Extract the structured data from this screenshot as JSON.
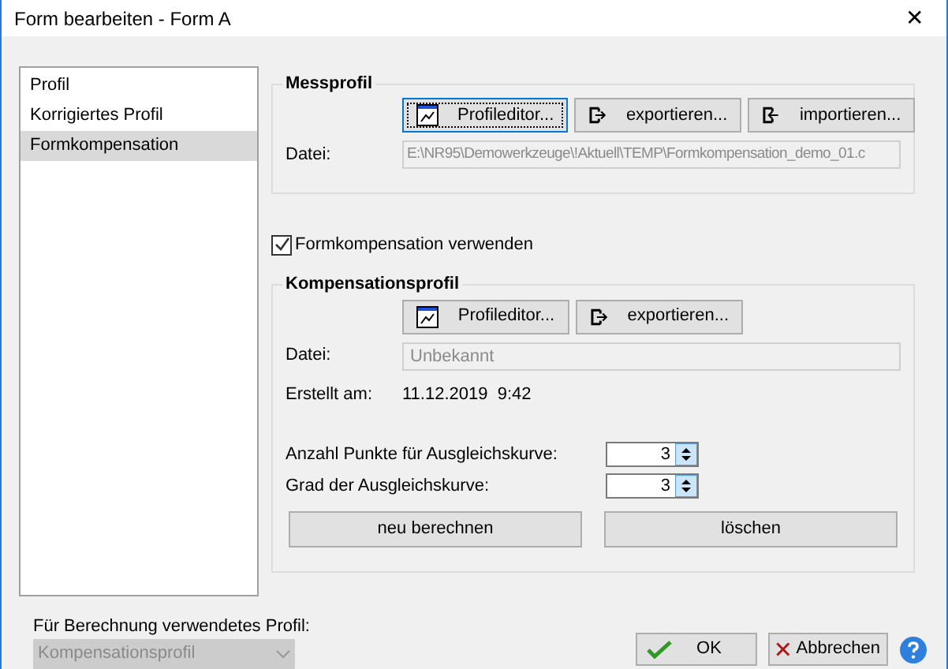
{
  "window": {
    "title": "Form bearbeiten - Form A",
    "close": "✕"
  },
  "sidebar": {
    "items": [
      {
        "label": "Profil",
        "selected": false
      },
      {
        "label": "Korrigiertes Profil",
        "selected": false
      },
      {
        "label": "Formkompensation",
        "selected": true
      }
    ]
  },
  "messprofil": {
    "title": "Messprofil",
    "buttons": [
      {
        "label": "Profileditor...",
        "kind": "editor",
        "focused": true
      },
      {
        "label": "exportieren...",
        "kind": "export",
        "focused": false
      },
      {
        "label": "importieren...",
        "kind": "import",
        "focused": false
      }
    ],
    "file_label": "Datei:",
    "file_value": "E:\\NR95\\Demowerkzeuge\\!Aktuell\\TEMP\\Formkompensation_demo_01.c"
  },
  "use_compensation": {
    "label": "Formkompensation verwenden",
    "checked": true
  },
  "kompensationsprofil": {
    "title": "Kompensationsprofil",
    "buttons": [
      {
        "label": "Profileditor...",
        "kind": "editor",
        "focused": false
      },
      {
        "label": "exportieren...",
        "kind": "export",
        "focused": false
      }
    ],
    "file_label": "Datei:",
    "file_value": "Unbekannt",
    "created_label": "Erstellt am:",
    "created_value": "11.12.2019  9:42",
    "spinners": [
      {
        "label": "Anzahl Punkte für Ausgleichskurve:",
        "value": "3"
      },
      {
        "label": "Grad der Ausgleichskurve:",
        "value": "3"
      }
    ],
    "actions": [
      "neu berechnen",
      "löschen"
    ]
  },
  "footer": {
    "profile_label": "Für Berechnung verwendetes Profil:",
    "profile_value": "Kompensationsprofil",
    "ok": "OK",
    "cancel": "Abbrechen"
  }
}
